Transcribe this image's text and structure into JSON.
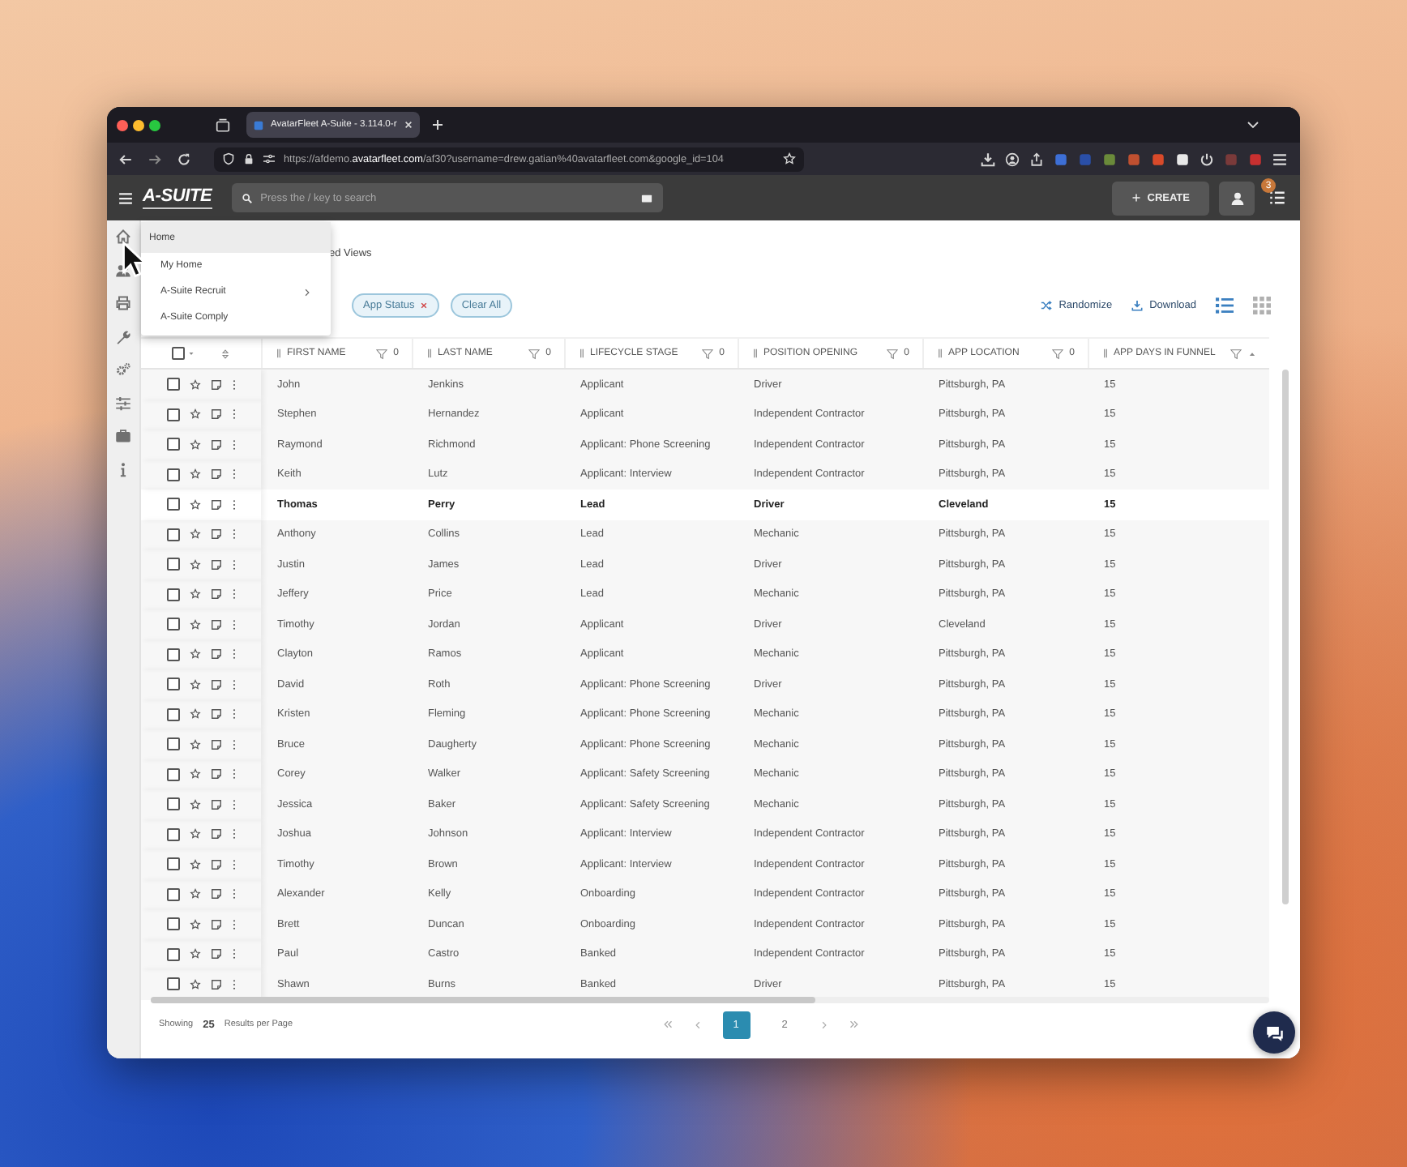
{
  "browser": {
    "tab_title": "AvatarFleet A-Suite - 3.114.0-r",
    "url": "https://afdemo.**avatarfleet.com**/af30?username=drew.gatian%40avatarfleet.com&google_id=104"
  },
  "app_header": {
    "logo": "A-SUITE",
    "search_placeholder": "Press the / key to search",
    "create_label": "CREATE",
    "notification_count": "3"
  },
  "nav_menu": {
    "label": "Home",
    "selected": true,
    "children": [
      {
        "label": "My Home",
        "selected": false,
        "submenu": false
      },
      {
        "label": "A-Suite Recruit",
        "selected": false,
        "submenu": true
      },
      {
        "label": "A-Suite Comply",
        "selected": false,
        "submenu": false
      }
    ]
  },
  "saved_views_label": "ed Views",
  "filters": {
    "chips": [
      {
        "label": "App Status",
        "removable": true
      }
    ],
    "clear_label": "Clear All"
  },
  "actions": [
    {
      "kind": "randomize",
      "label": "Randomize"
    },
    {
      "kind": "download",
      "label": "Download"
    }
  ],
  "view_modes": [
    {
      "kind": "list",
      "selected": true
    },
    {
      "kind": "grid",
      "selected": false
    }
  ],
  "table": {
    "select_all_checked": false,
    "columns": [
      {
        "label": "FIRST NAME",
        "filter_count": "0",
        "sorted": false
      },
      {
        "label": "LAST NAME",
        "filter_count": "0",
        "sorted": false
      },
      {
        "label": "LIFECYCLE STAGE",
        "filter_count": "0",
        "sorted": false
      },
      {
        "label": "POSITION OPENING",
        "filter_count": "0",
        "sorted": false
      },
      {
        "label": "APP LOCATION",
        "filter_count": "0",
        "sorted": false
      },
      {
        "label": "APP DAYS IN FUNNEL",
        "sorted": true
      }
    ],
    "rows": [
      {
        "cells": [
          "John",
          "Jenkins",
          "Applicant",
          "Driver",
          "Pittsburgh, PA",
          "15"
        ],
        "selected": false,
        "checked": false,
        "starred": false
      },
      {
        "cells": [
          "Stephen",
          "Hernandez",
          "Applicant",
          "Independent Contractor",
          "Pittsburgh, PA",
          "15"
        ],
        "selected": false,
        "checked": false,
        "starred": false
      },
      {
        "cells": [
          "Raymond",
          "Richmond",
          "Applicant: Phone Screening",
          "Independent Contractor",
          "Pittsburgh, PA",
          "15"
        ],
        "selected": false,
        "checked": false,
        "starred": false
      },
      {
        "cells": [
          "Keith",
          "Lutz",
          "Applicant: Interview",
          "Independent Contractor",
          "Pittsburgh, PA",
          "15"
        ],
        "selected": false,
        "checked": false,
        "starred": false
      },
      {
        "cells": [
          "Thomas",
          "Perry",
          "Lead",
          "Driver",
          "Cleveland",
          "15"
        ],
        "selected": true,
        "checked": false,
        "starred": false
      },
      {
        "cells": [
          "Anthony",
          "Collins",
          "Lead",
          "Mechanic",
          "Pittsburgh, PA",
          "15"
        ],
        "selected": false,
        "checked": false,
        "starred": false
      },
      {
        "cells": [
          "Justin",
          "James",
          "Lead",
          "Driver",
          "Pittsburgh, PA",
          "15"
        ],
        "selected": false,
        "checked": false,
        "starred": false
      },
      {
        "cells": [
          "Jeffery",
          "Price",
          "Lead",
          "Mechanic",
          "Pittsburgh, PA",
          "15"
        ],
        "selected": false,
        "checked": false,
        "starred": false
      },
      {
        "cells": [
          "Timothy",
          "Jordan",
          "Applicant",
          "Driver",
          "Cleveland",
          "15"
        ],
        "selected": false,
        "checked": false,
        "starred": false
      },
      {
        "cells": [
          "Clayton",
          "Ramos",
          "Applicant",
          "Mechanic",
          "Pittsburgh, PA",
          "15"
        ],
        "selected": false,
        "checked": false,
        "starred": false
      },
      {
        "cells": [
          "David",
          "Roth",
          "Applicant: Phone Screening",
          "Driver",
          "Pittsburgh, PA",
          "15"
        ],
        "selected": false,
        "checked": false,
        "starred": false
      },
      {
        "cells": [
          "Kristen",
          "Fleming",
          "Applicant: Phone Screening",
          "Mechanic",
          "Pittsburgh, PA",
          "15"
        ],
        "selected": false,
        "checked": false,
        "starred": false
      },
      {
        "cells": [
          "Bruce",
          "Daugherty",
          "Applicant: Phone Screening",
          "Mechanic",
          "Pittsburgh, PA",
          "15"
        ],
        "selected": false,
        "checked": false,
        "starred": false
      },
      {
        "cells": [
          "Corey",
          "Walker",
          "Applicant: Safety Screening",
          "Mechanic",
          "Pittsburgh, PA",
          "15"
        ],
        "selected": false,
        "checked": false,
        "starred": false
      },
      {
        "cells": [
          "Jessica",
          "Baker",
          "Applicant: Safety Screening",
          "Mechanic",
          "Pittsburgh, PA",
          "15"
        ],
        "selected": false,
        "checked": false,
        "starred": false
      },
      {
        "cells": [
          "Joshua",
          "Johnson",
          "Applicant: Interview",
          "Independent Contractor",
          "Pittsburgh, PA",
          "15"
        ],
        "selected": false,
        "checked": false,
        "starred": false
      },
      {
        "cells": [
          "Timothy",
          "Brown",
          "Applicant: Interview",
          "Independent Contractor",
          "Pittsburgh, PA",
          "15"
        ],
        "selected": false,
        "checked": false,
        "starred": false
      },
      {
        "cells": [
          "Alexander",
          "Kelly",
          "Onboarding",
          "Independent Contractor",
          "Pittsburgh, PA",
          "15"
        ],
        "selected": false,
        "checked": false,
        "starred": false
      },
      {
        "cells": [
          "Brett",
          "Duncan",
          "Onboarding",
          "Independent Contractor",
          "Pittsburgh, PA",
          "15"
        ],
        "selected": false,
        "checked": false,
        "starred": false
      },
      {
        "cells": [
          "Paul",
          "Castro",
          "Banked",
          "Independent Contractor",
          "Pittsburgh, PA",
          "15"
        ],
        "selected": false,
        "checked": false,
        "starred": false
      },
      {
        "cells": [
          "Shawn",
          "Burns",
          "Banked",
          "Driver",
          "Pittsburgh, PA",
          "15"
        ],
        "selected": false,
        "checked": false,
        "starred": false
      }
    ]
  },
  "footer": {
    "showing_label": "Showing",
    "page_size": "25",
    "per_page_label": "Results per Page",
    "pages": [
      {
        "label": "1",
        "selected": true
      },
      {
        "label": "2",
        "selected": false
      }
    ]
  }
}
